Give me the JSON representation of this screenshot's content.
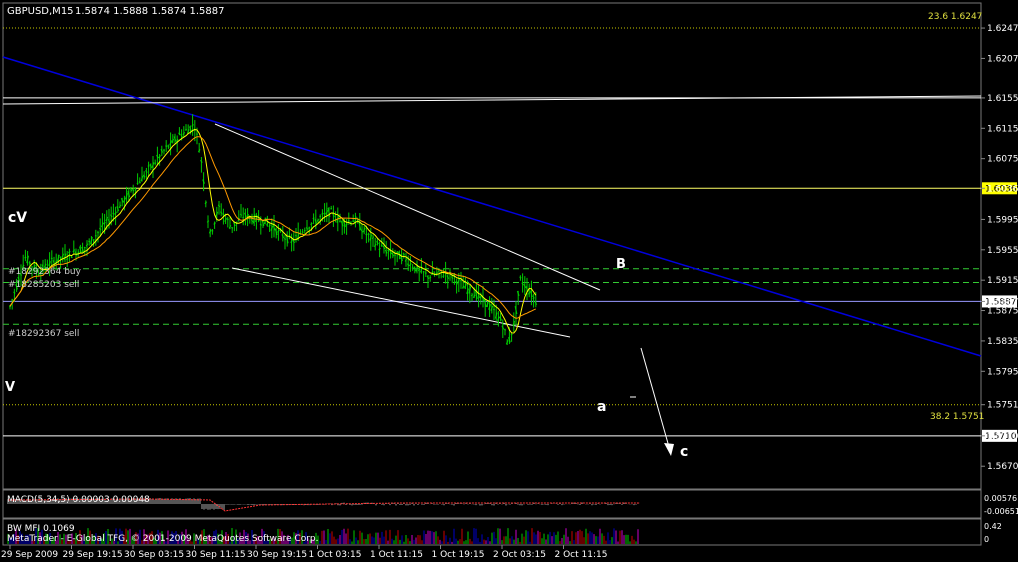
{
  "header": {
    "symbol": "GBPUSD,M15",
    "ohlc": "1.5874 1.5888 1.5874 1.5887"
  },
  "chart_data": {
    "type": "candlestick",
    "symbol": "GBPUSD",
    "timeframe": "M15",
    "ylim": [
      1.564,
      1.628
    ],
    "y_ticks": [
      "1.6247",
      "1.6207",
      "1.6155",
      "1.6115",
      "1.6075",
      "1.6036",
      "1.5995",
      "1.5955",
      "1.5915",
      "1.5887",
      "1.5875",
      "1.5835",
      "1.5795",
      "1.5751",
      "1.5710",
      "1.5670"
    ],
    "x_ticks": [
      "29 Sep 2009",
      "29 Sep 19:15",
      "30 Sep 03:15",
      "30 Sep 11:15",
      "30 Sep 19:15",
      "1 Oct 03:15",
      "1 Oct 11:15",
      "1 Oct 19:15",
      "2 Oct 03:15",
      "2 Oct 11:15"
    ],
    "price_path": [
      [
        0.0,
        1.588
      ],
      [
        0.25,
        1.5945
      ],
      [
        0.45,
        1.5925
      ],
      [
        0.7,
        1.594
      ],
      [
        1.0,
        1.595
      ],
      [
        1.25,
        1.596
      ],
      [
        1.5,
        1.5985
      ],
      [
        1.75,
        1.601
      ],
      [
        2.0,
        1.6035
      ],
      [
        2.25,
        1.606
      ],
      [
        2.5,
        1.6085
      ],
      [
        2.75,
        1.6105
      ],
      [
        3.0,
        1.612
      ],
      [
        3.1,
        1.608
      ],
      [
        3.25,
        1.5975
      ],
      [
        3.4,
        1.601
      ],
      [
        3.6,
        1.5985
      ],
      [
        3.8,
        1.6
      ],
      [
        4.0,
        1.5995
      ],
      [
        4.2,
        1.599
      ],
      [
        4.4,
        1.5975
      ],
      [
        4.6,
        1.5965
      ],
      [
        4.8,
        1.5985
      ],
      [
        5.0,
        1.5995
      ],
      [
        5.2,
        1.6005
      ],
      [
        5.4,
        1.599
      ],
      [
        5.6,
        1.5995
      ],
      [
        5.8,
        1.5975
      ],
      [
        6.0,
        1.596
      ],
      [
        6.2,
        1.595
      ],
      [
        6.4,
        1.5945
      ],
      [
        6.6,
        1.593
      ],
      [
        6.8,
        1.592
      ],
      [
        7.0,
        1.5925
      ],
      [
        7.2,
        1.592
      ],
      [
        7.4,
        1.5905
      ],
      [
        7.6,
        1.5895
      ],
      [
        7.8,
        1.588
      ],
      [
        8.0,
        1.586
      ],
      [
        8.1,
        1.583
      ],
      [
        8.2,
        1.586
      ],
      [
        8.3,
        1.5915
      ],
      [
        8.45,
        1.59
      ],
      [
        8.55,
        1.5887
      ]
    ],
    "horizontal_levels": [
      {
        "price": 1.6155,
        "color": "#ffffff",
        "label": ""
      },
      {
        "price": 1.6036,
        "color": "#ffff66",
        "label": "1.6036"
      },
      {
        "price": 1.5887,
        "color": "#9999ff",
        "label": "1.5887"
      },
      {
        "price": 1.571,
        "color": "#ffffff",
        "label": "1.5710"
      }
    ],
    "dashed_levels": [
      1.593,
      1.5912,
      1.5857
    ],
    "order_labels": [
      "#18292364 buy",
      "#18285203 sell",
      "#18292367 sell"
    ],
    "fib_labels": [
      "23.6 1.6247",
      "38.2 1.5751"
    ],
    "wave_labels": [
      "cV",
      "V",
      "B",
      "a",
      "c"
    ],
    "indicators": [
      {
        "name": "MACD(5,34,5) 0.00003 0.00048",
        "ticks": [
          "0.00576",
          "-0.00651"
        ]
      },
      {
        "name": "BW MFI 0.1069",
        "ticks": [
          "0.42",
          "0"
        ]
      }
    ],
    "footer": "MetaTrader - E-Global TFG, © 2001-2009 MetaQuotes Software Corp."
  },
  "colors": {
    "background": "#000000",
    "candles": "#00cc00",
    "ma_fast": "#ffff00",
    "ma_slow": "#ff9900",
    "trend_line": "#0000dd",
    "channel": "#ffffff",
    "price_label_bg": "#ffff00"
  }
}
